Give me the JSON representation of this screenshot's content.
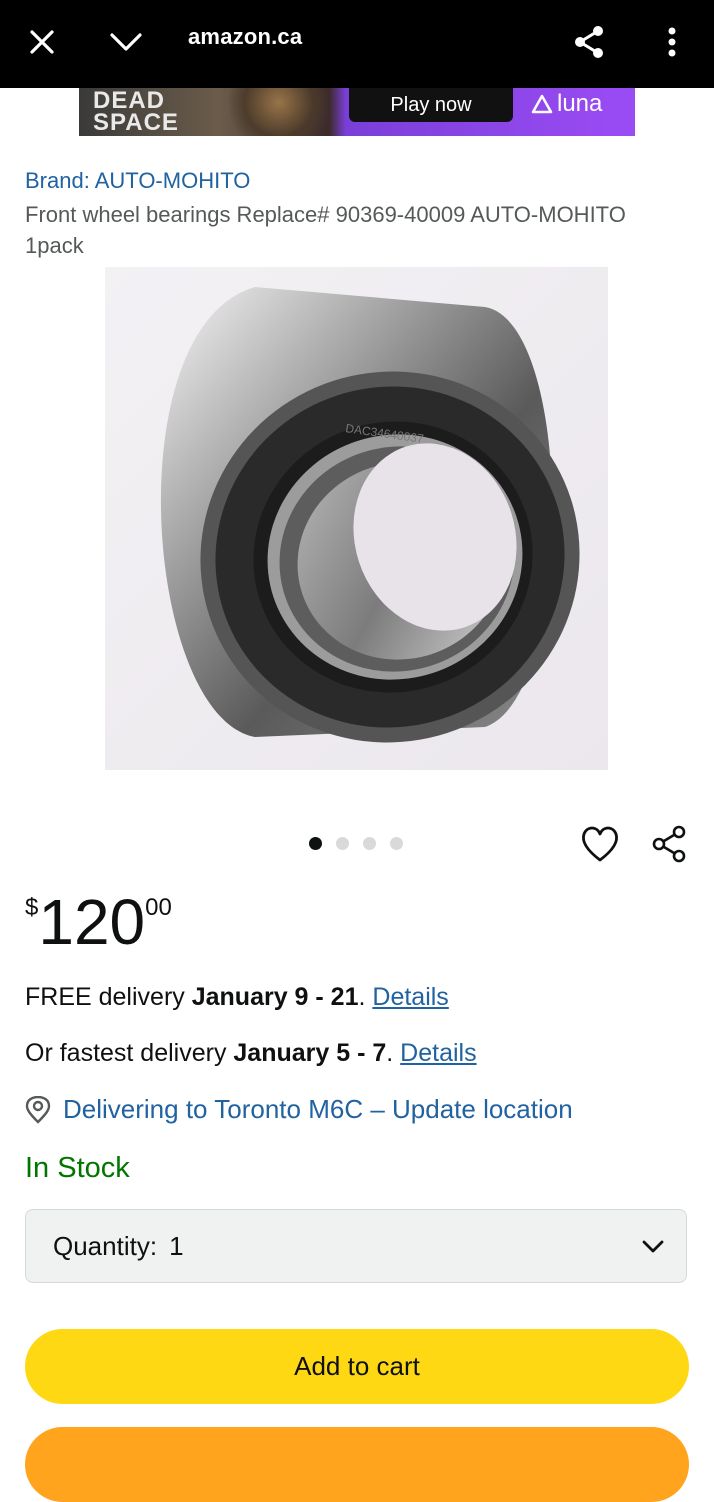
{
  "browser": {
    "url": "amazon.ca",
    "close_icon": "close-icon",
    "tabs_icon": "chevron-down-icon",
    "share_icon": "share-icon",
    "menu_icon": "more-vert-icon"
  },
  "ad": {
    "game": "DEAD SPACE",
    "play_label": "Play now",
    "brand": "luna"
  },
  "product": {
    "brand_line": "Brand: AUTO-MOHITO",
    "title": "Front wheel bearings Replace# 90369-40009 AUTO-MOHITO 1pack",
    "image_part_number": "DAC34640037",
    "carousel": {
      "count": 4,
      "active_index": 0
    },
    "price": {
      "symbol": "$",
      "whole": "120",
      "fraction": "00"
    }
  },
  "delivery": {
    "free_prefix": "FREE delivery ",
    "free_dates": "January 9 - 21",
    "free_period": ". ",
    "free_details": "Details",
    "fast_prefix": "Or fastest delivery ",
    "fast_dates": "January 5 - 7",
    "fast_period": ". ",
    "fast_details": "Details",
    "location": "Delivering to Toronto M6C – Update location"
  },
  "stock": "In Stock",
  "quantity": {
    "label": "Quantity:",
    "value": "1"
  },
  "buttons": {
    "add_to_cart": "Add to cart"
  },
  "colors": {
    "link": "#2162a1",
    "in_stock": "#007600",
    "add_to_cart": "#ffd814",
    "buy_now": "#ffa41c"
  }
}
